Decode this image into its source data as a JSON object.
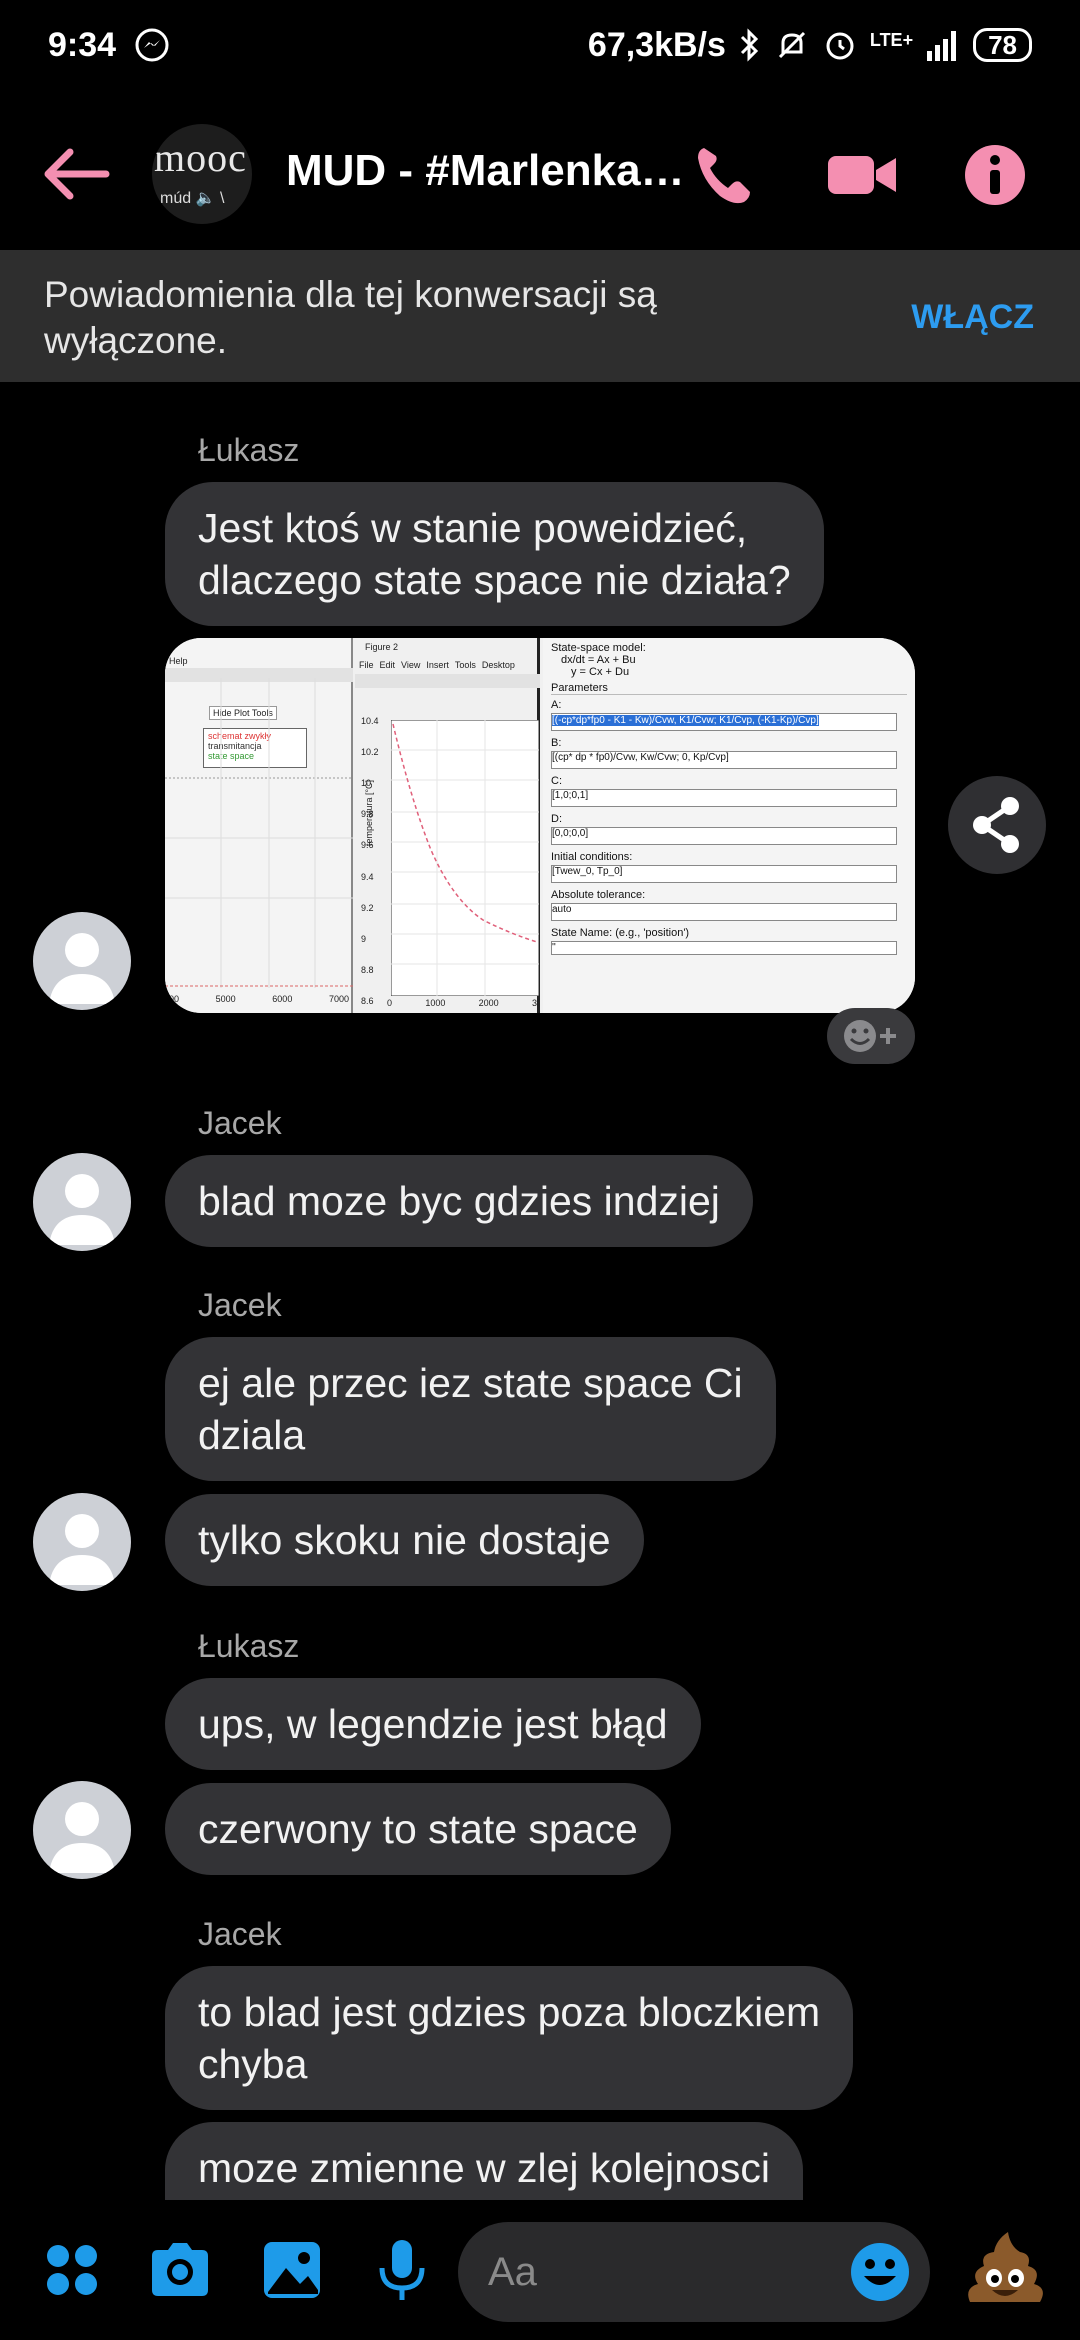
{
  "status_bar": {
    "time": "9:34",
    "speed": "67,3kB/s",
    "network": "LTE+",
    "battery": "78"
  },
  "header": {
    "title": "MUD - #Marlenka…",
    "avatar_text": "mooc",
    "avatar_subtext": "múd 🔈 \\"
  },
  "notice": {
    "text": "Powiadomienia dla tej konwersacji są wyłączone.",
    "button": "WŁĄCZ"
  },
  "messages": [
    {
      "sender": "Łukasz",
      "text": "Jest ktoś w stanie poweidzieć,\ndlaczego state space nie działa?"
    },
    {
      "sender": "Jacek",
      "text": "blad moze byc gdzies indziej"
    },
    {
      "sender": "Jacek",
      "text": "ej ale przec iez state space Ci\ndziala"
    },
    {
      "sender": "",
      "text": "tylko skoku nie dostaje"
    },
    {
      "sender": "Łukasz",
      "text": "ups, w legendzie jest błąd"
    },
    {
      "sender": "",
      "text": "czerwony to state space"
    },
    {
      "sender": "Jacek",
      "text": "to blad jest gdzies poza bloczkiem\nchyba"
    },
    {
      "sender": "",
      "text": "moze zmienne w zlej kolejnosci"
    }
  ],
  "screenshot": {
    "left_panel": {
      "menu": "Help",
      "button": "Hide Plot Tools",
      "legend": [
        "schemat zwykły",
        "transmitancja",
        "state space"
      ],
      "xticks": [
        "00",
        "5000",
        "6000",
        "7000"
      ]
    },
    "figure": {
      "title": "Figure 2",
      "menu": [
        "File",
        "Edit",
        "View",
        "Insert",
        "Tools",
        "Desktop"
      ],
      "ylabel": "temperatura [°C]",
      "yticks": [
        "10.4",
        "10.2",
        "10",
        "9.8",
        "9.6",
        "9.4",
        "9.2",
        "9",
        "8.8",
        "8.6"
      ],
      "xticks": [
        "0",
        "1000",
        "2000",
        "3"
      ]
    },
    "dialog": {
      "model_title": "State-space model:",
      "eq1": "dx/dt = Ax + Bu",
      "eq2": "y = Cx + Du",
      "params": "Parameters",
      "a_label": "A:",
      "a_value": "[(-cp*dp*fp0 - K1 - Kw)/Cvw,  K1/Cvw;  K1/Cvp,  (-K1-Kp)/Cvp]",
      "b_label": "B:",
      "b_value": "[(cp* dp * fp0)/Cvw,  Kw/Cvw;  0,  Kp/Cvp]",
      "c_label": "C:",
      "c_value": "[1,0;0,1]",
      "d_label": "D:",
      "d_value": "[0,0;0,0]",
      "ic_label": "Initial conditions:",
      "ic_value": "[Twew_0, Tp_0]",
      "tol_label": "Absolute tolerance:",
      "tol_value": "auto",
      "state_label": "State Name: (e.g., 'position')",
      "state_value": "''"
    }
  },
  "composer": {
    "placeholder": "Aa"
  },
  "colors": {
    "accent": "#f48fb1",
    "link": "#2d9cf0",
    "bubble": "#333336",
    "icon_blue": "#1e9be9"
  }
}
